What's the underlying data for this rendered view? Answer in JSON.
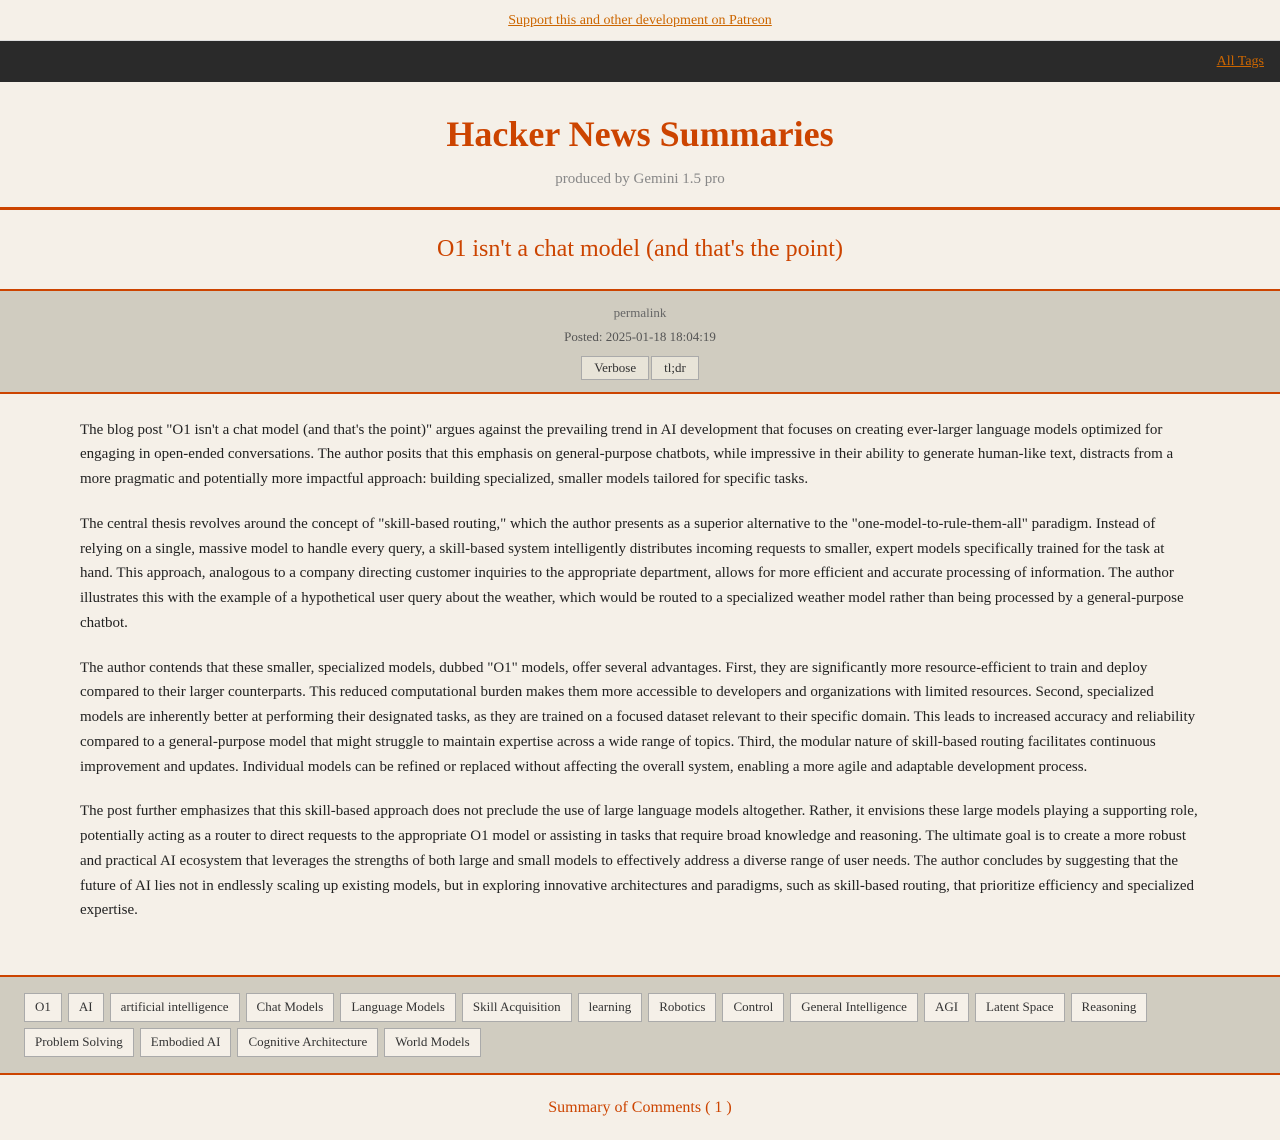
{
  "top_banner": {
    "link_text": "Support this and other development on Patreon",
    "link_href": "#"
  },
  "all_tags": {
    "label": "All Tags",
    "link_href": "#"
  },
  "header": {
    "title": "Hacker News Summaries",
    "subtitle": "produced by Gemini 1.5 pro"
  },
  "article": {
    "title": "O1 isn't a chat model (and that's the point)",
    "permalink_label": "permalink",
    "permalink_href": "#",
    "posted": "Posted: 2025-01-18 18:04:19",
    "buttons": {
      "verbose": "Verbose",
      "tldr": "tl;dr"
    },
    "paragraphs": [
      "The blog post \"O1 isn't a chat model (and that's the point)\" argues against the prevailing trend in AI development that focuses on creating ever-larger language models optimized for engaging in open-ended conversations. The author posits that this emphasis on general-purpose chatbots, while impressive in their ability to generate human-like text, distracts from a more pragmatic and potentially more impactful approach: building specialized, smaller models tailored for specific tasks.",
      "The central thesis revolves around the concept of \"skill-based routing,\" which the author presents as a superior alternative to the \"one-model-to-rule-them-all\" paradigm. Instead of relying on a single, massive model to handle every query, a skill-based system intelligently distributes incoming requests to smaller, expert models specifically trained for the task at hand. This approach, analogous to a company directing customer inquiries to the appropriate department, allows for more efficient and accurate processing of information. The author illustrates this with the example of a hypothetical user query about the weather, which would be routed to a specialized weather model rather than being processed by a general-purpose chatbot.",
      "The author contends that these smaller, specialized models, dubbed \"O1\" models, offer several advantages. First, they are significantly more resource-efficient to train and deploy compared to their larger counterparts. This reduced computational burden makes them more accessible to developers and organizations with limited resources. Second, specialized models are inherently better at performing their designated tasks, as they are trained on a focused dataset relevant to their specific domain. This leads to increased accuracy and reliability compared to a general-purpose model that might struggle to maintain expertise across a wide range of topics. Third, the modular nature of skill-based routing facilitates continuous improvement and updates. Individual models can be refined or replaced without affecting the overall system, enabling a more agile and adaptable development process.",
      "The post further emphasizes that this skill-based approach does not preclude the use of large language models altogether. Rather, it envisions these large models playing a supporting role, potentially acting as a router to direct requests to the appropriate O1 model or assisting in tasks that require broad knowledge and reasoning. The ultimate goal is to create a more robust and practical AI ecosystem that leverages the strengths of both large and small models to effectively address a diverse range of user needs. The author concludes by suggesting that the future of AI lies not in endlessly scaling up existing models, but in exploring innovative architectures and paradigms, such as skill-based routing, that prioritize efficiency and specialized expertise."
    ]
  },
  "tags": [
    "O1",
    "AI",
    "artificial intelligence",
    "Chat Models",
    "Language Models",
    "Skill Acquisition",
    "learning",
    "Robotics",
    "Control",
    "General Intelligence",
    "AGI",
    "Latent Space",
    "Reasoning",
    "Problem Solving",
    "Embodied AI",
    "Cognitive Architecture",
    "World Models"
  ],
  "summary_footer": {
    "label": "Summary of Comments ( 1 )"
  }
}
